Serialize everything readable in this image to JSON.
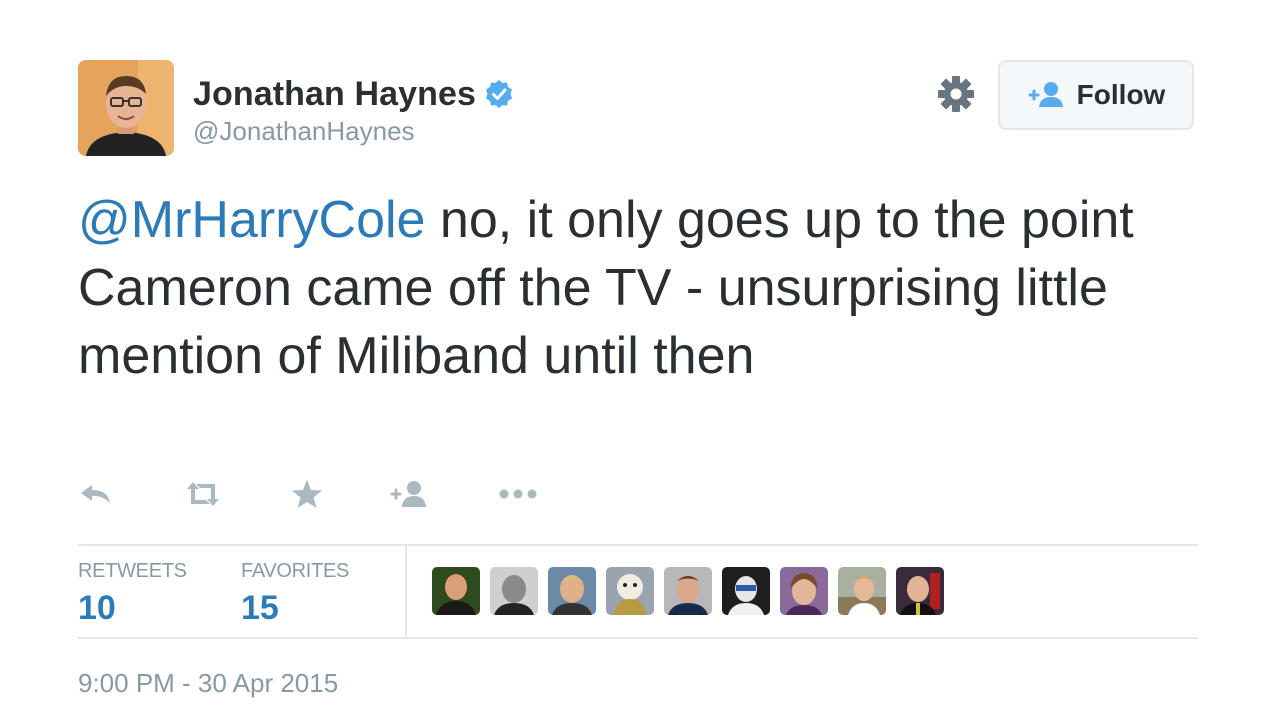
{
  "user": {
    "name": "Jonathan Haynes",
    "screen_name": "@JonathanHaynes",
    "verified": true,
    "avatar_icon": "profile-photo"
  },
  "header": {
    "settings_icon": "gear-icon",
    "follow_label": "Follow",
    "follow_icon": "add-user-icon"
  },
  "tweet": {
    "mention": "@MrHarryCole",
    "text": " no, it only goes up to the point Cameron came off the TV - unsurprising little mention of Miliband until then"
  },
  "actions": [
    {
      "name": "reply",
      "icon": "reply-icon"
    },
    {
      "name": "retweet",
      "icon": "retweet-icon"
    },
    {
      "name": "favorite",
      "icon": "star-icon"
    },
    {
      "name": "follow",
      "icon": "add-user-icon"
    },
    {
      "name": "more",
      "icon": "more-icon"
    }
  ],
  "stats": {
    "retweets_label": "RETWEETS",
    "retweets_count": "10",
    "favorites_label": "FAVORITES",
    "favorites_count": "15"
  },
  "timestamp": "9:00 PM - 30 Apr 2015",
  "colors": {
    "link": "#2b7bb9",
    "text": "#292f33",
    "muted": "#8899a6",
    "border": "#e1e8ed",
    "verified": "#55acee",
    "icon": "#aab8c2"
  }
}
